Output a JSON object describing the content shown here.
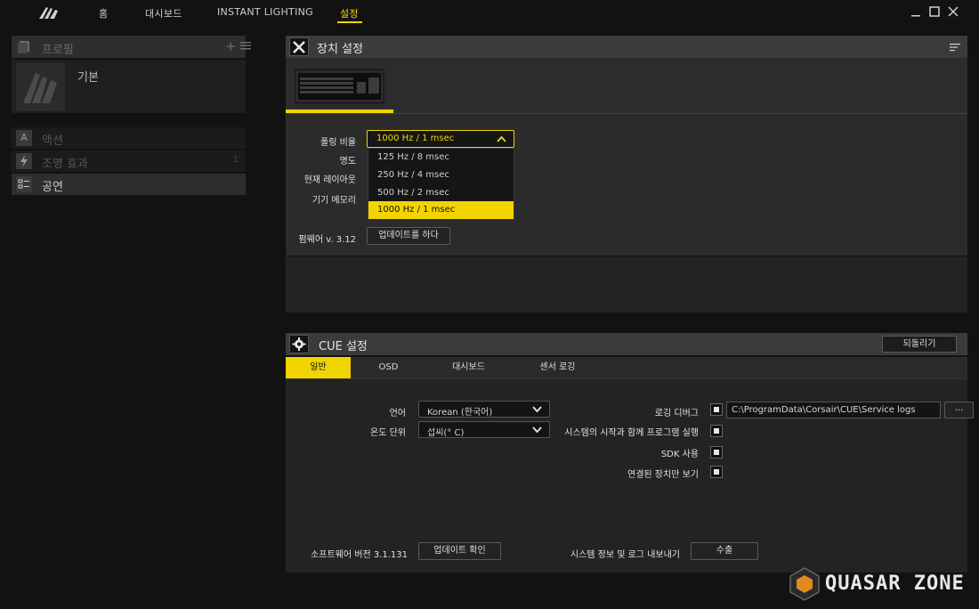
{
  "nav": {
    "items": [
      {
        "label": "홈"
      },
      {
        "label": "대시보드"
      },
      {
        "label": "INSTANT LIGHTING"
      },
      {
        "label": "설정"
      }
    ],
    "active_index": 3,
    "accent_color": "#f2d400"
  },
  "sidebar": {
    "profile_header": "프로필",
    "add_symbol": "+",
    "profile_name": "기본",
    "items": [
      {
        "label": "액션",
        "icon": "A",
        "count": ""
      },
      {
        "label": "조명 효과",
        "icon": "bolt-icon",
        "count": "1"
      },
      {
        "label": "공연",
        "icon": "performance-icon",
        "count": ""
      }
    ]
  },
  "device_settings": {
    "title": "장치 설정",
    "labels": {
      "polling": "폴링 비율",
      "brightness": "명도",
      "layout": "현재 레이아웃",
      "memory": "기기 메모리",
      "firmware": "펌웨어 v. 3.12"
    },
    "polling_dropdown": {
      "value": "1000 Hz / 1 msec",
      "options": [
        "125 Hz / 8 msec",
        "250 Hz / 4 msec",
        "500 Hz / 2 msec",
        "1000 Hz / 1 msec"
      ],
      "selected_index": 3
    },
    "update_button": "업데이트를 하다"
  },
  "cue_settings": {
    "title": "CUE 설정",
    "restore_button": "되돌리기",
    "tabs": [
      "일반",
      "OSD",
      "대시보드",
      "센서 로깅"
    ],
    "active_tab": 0,
    "language_label": "언어",
    "language_value": "Korean (한국어)",
    "temp_label": "온도 단위",
    "temp_value": "섭씨(° C)",
    "log_debug_label": "로깅 디버그",
    "log_path": "C:\\ProgramData\\Corsair\\CUE\\Service logs",
    "browse_button": "...",
    "startup_label": "시스템의 시작과 함께 프로그램 실행",
    "sdk_label": "SDK 사용",
    "connected_only_label": "연결된 장치만 보기",
    "software_version": "소프트웨어 버전 3.1.131",
    "check_update_button": "업데이트 확인",
    "export_label": "시스템 정보 및 로그 내보내기",
    "export_button": "수출"
  },
  "watermark": {
    "text": "QUASAR ZONE"
  }
}
